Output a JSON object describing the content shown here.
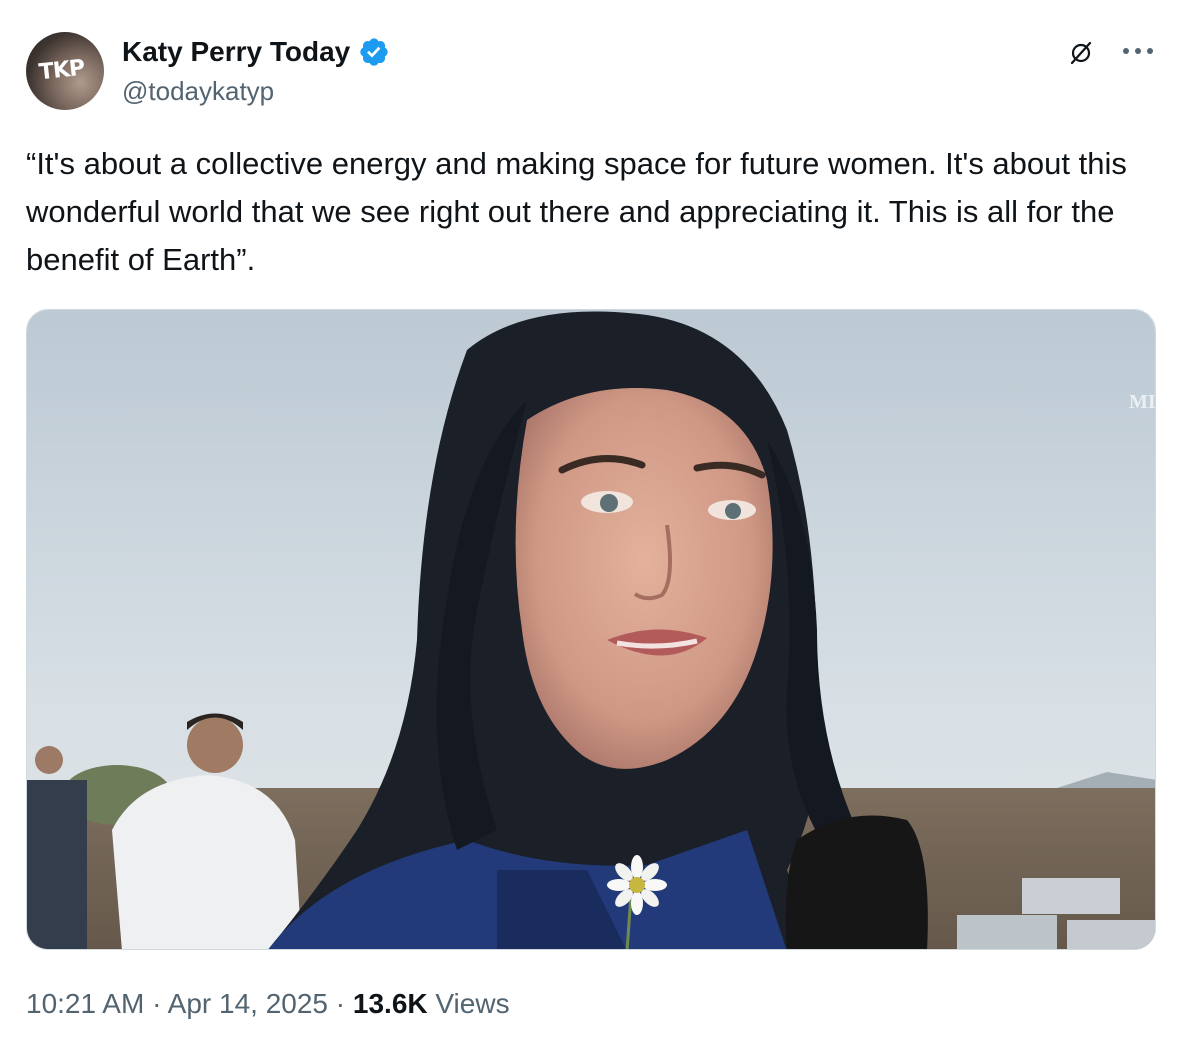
{
  "author": {
    "display_name": "Katy Perry Today",
    "handle": "@todaykatyp",
    "avatar_monogram": "TKP",
    "verified": true,
    "verified_icon": "verified-badge-icon"
  },
  "actions": {
    "grok_icon": "grok-slash-icon",
    "more_icon": "more-options-icon"
  },
  "tweet": {
    "text": "“It's about a collective energy and making space for future women. It's about this wonderful world that we see right out there and appreciating it. This is all for the benefit of Earth”."
  },
  "media": {
    "type": "video-thumbnail",
    "watermark": "MI"
  },
  "meta": {
    "time": "10:21 AM",
    "separator": " · ",
    "date": "Apr 14, 2025",
    "views_count": "13.6K",
    "views_label": "Views"
  },
  "colors": {
    "verified": "#1d9bf0",
    "text_primary": "#0f1419",
    "text_secondary": "#536471",
    "border": "#cfd9de"
  }
}
